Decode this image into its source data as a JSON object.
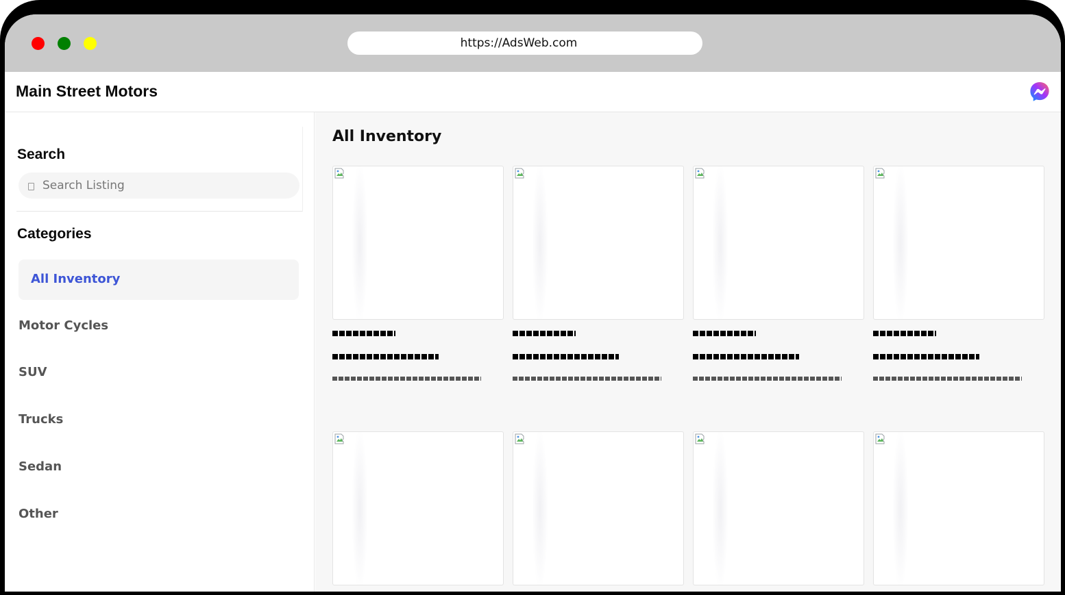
{
  "browser": {
    "url": "https://AdsWeb.com"
  },
  "header": {
    "site_title": "Main Street Motors",
    "messenger_icon": "messenger-icon"
  },
  "sidebar": {
    "search_heading": "Search",
    "search_placeholder": "Search Listing",
    "categories_heading": "Categories",
    "categories": [
      {
        "label": "All Inventory",
        "active": true
      },
      {
        "label": "Motor Cycles",
        "active": false
      },
      {
        "label": "SUV",
        "active": false
      },
      {
        "label": "Trucks",
        "active": false
      },
      {
        "label": "Sedan",
        "active": false
      },
      {
        "label": "Other",
        "active": false
      }
    ]
  },
  "main": {
    "title": "All Inventory",
    "listing_count_visible": 8
  },
  "colors": {
    "accent": "#3d55d6",
    "chrome": "#c9c9c9",
    "dot_red": "#ff0000",
    "dot_green": "#008000",
    "dot_yellow": "#ffff00",
    "messenger_gradient": [
      "#0695ff",
      "#a334fa",
      "#ff6968"
    ]
  }
}
